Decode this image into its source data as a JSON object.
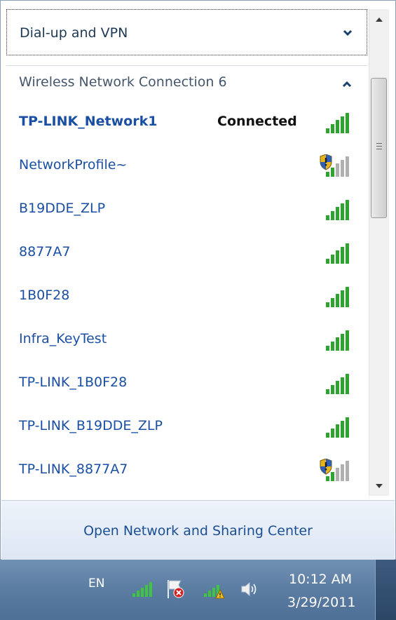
{
  "dialup": {
    "title": "Dial-up and VPN",
    "expand_icon": "chevron-down-icon"
  },
  "wireless": {
    "title": "Wireless Network Connection 6",
    "collapse_icon": "chevron-up-icon",
    "networks": [
      {
        "name": "TP-LINK_Network1",
        "status": "Connected",
        "secured_warning": false,
        "connected": true
      },
      {
        "name": "NetworkProfile~",
        "status": "",
        "secured_warning": true,
        "connected": false
      },
      {
        "name": "B19DDE_ZLP",
        "status": "",
        "secured_warning": false,
        "connected": false
      },
      {
        "name": "8877A7",
        "status": "",
        "secured_warning": false,
        "connected": false
      },
      {
        "name": "1B0F28",
        "status": "",
        "secured_warning": false,
        "connected": false
      },
      {
        "name": "Infra_KeyTest",
        "status": "",
        "secured_warning": false,
        "connected": false
      },
      {
        "name": "TP-LINK_1B0F28",
        "status": "",
        "secured_warning": false,
        "connected": false
      },
      {
        "name": "TP-LINK_B19DDE_ZLP",
        "status": "",
        "secured_warning": false,
        "connected": false
      },
      {
        "name": "TP-LINK_8877A7",
        "status": "",
        "secured_warning": true,
        "connected": false
      }
    ]
  },
  "footer": {
    "link": "Open Network and Sharing Center"
  },
  "taskbar": {
    "language": "EN",
    "time": "10:12 AM",
    "date": "3/29/2011",
    "icons": [
      "wifi-signal-icon",
      "action-center-flag-icon",
      "network-warning-icon",
      "speaker-icon"
    ]
  },
  "colors": {
    "signal_green": "#2fa32f",
    "signal_gray": "#b0b0b0",
    "link_blue": "#1a4fa3",
    "shield_yellow": "#e8b320"
  }
}
